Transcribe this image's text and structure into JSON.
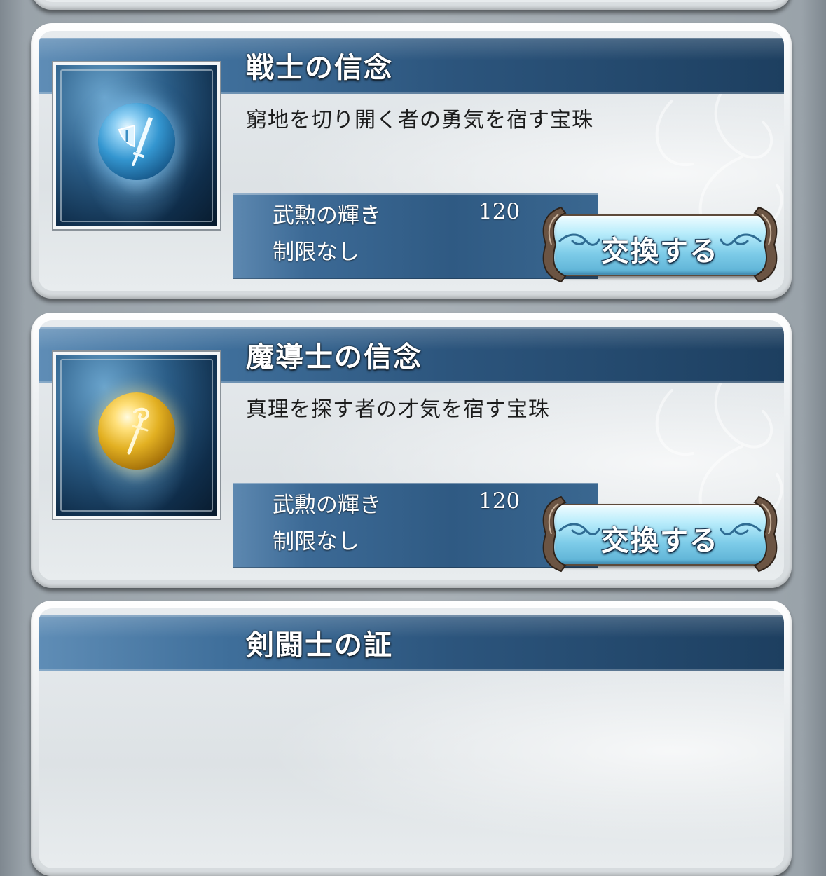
{
  "colors": {
    "header_band": "#2c557d",
    "cost_panel": "#2f5a83",
    "button_fill": "#7ccbe8",
    "button_frame": "#5d4a3a"
  },
  "items": [
    {
      "title": "戦士の信念",
      "description": "窮地を切り開く者の勇気を宿す宝珠",
      "icon": "warrior-orb-icon",
      "cost_currency": "武勲の輝き",
      "cost_amount": "120",
      "limit": "制限なし",
      "button_label": "交換する"
    },
    {
      "title": "魔導士の信念",
      "description": "真理を探す者の才気を宿す宝珠",
      "icon": "mage-orb-icon",
      "cost_currency": "武勲の輝き",
      "cost_amount": "120",
      "limit": "制限なし",
      "button_label": "交換する"
    },
    {
      "title": "剣闘士の証"
    }
  ]
}
